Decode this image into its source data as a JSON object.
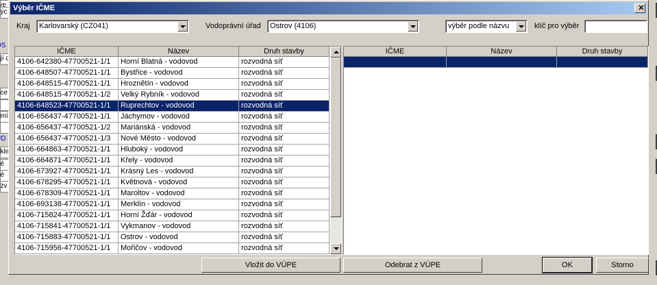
{
  "background_window": {
    "left_items": [
      "rve",
      "nýc",
      "OS",
      "ují d",
      "oce",
      "e",
      "emí",
      "í",
      "ÚD",
      "ákle",
      "né",
      "né",
      "ozv"
    ]
  },
  "dialog": {
    "title": "Výběr IČME",
    "close_glyph": "✕"
  },
  "filters": {
    "kraj_label": "Kraj",
    "kraj_value": "Karlovarský (CZ041)",
    "urad_label": "Vodoprávní úřad",
    "urad_value": "Ostrov (4106)",
    "mode_value": "výběr podle názvu",
    "key_label": "klíč pro výběr",
    "key_value": ""
  },
  "left_table": {
    "columns": [
      "IČME",
      "Název",
      "Druh stavby"
    ],
    "selected_index": 4,
    "rows": [
      [
        "4106-642380-47700521-1/1",
        "Horní Blatná - vodovod",
        "rozvodná síť"
      ],
      [
        "4106-648507-47700521-1/1",
        "Bystřice - vodovod",
        "rozvodná síť"
      ],
      [
        "4106-648515-47700521-1/1",
        "Hroznětín - vodovod",
        "rozvodná síť"
      ],
      [
        "4106-648515-47700521-1/2",
        "Velký Rybník - vodovod",
        "rozvodná síť"
      ],
      [
        "4106-648523-47700521-1/1",
        "Ruprechtov - vodovod",
        "rozvodná síť"
      ],
      [
        "4106-656437-47700521-1/1",
        "Jáchymov - vodovod",
        "rozvodná síť"
      ],
      [
        "4106-656437-47700521-1/2",
        "Mariánská - vodovod",
        "rozvodná síť"
      ],
      [
        "4106-656437-47700521-1/3",
        "Nové Město - vodovod",
        "rozvodná síť"
      ],
      [
        "4106-664863-47700521-1/1",
        "Hluboký - vodovod",
        "rozvodná síť"
      ],
      [
        "4106-664871-47700521-1/1",
        "Křely - vodovod",
        "rozvodná síť"
      ],
      [
        "4106-673927-47700521-1/1",
        "Krásný Les - vodovod",
        "rozvodná síť"
      ],
      [
        "4106-678295-47700521-1/1",
        "Květnová - vodovod",
        "rozvodná síť"
      ],
      [
        "4106-678309-47700521-1/1",
        "Maroltov - vodovod",
        "rozvodná síť"
      ],
      [
        "4106-693138-47700521-1/1",
        "Merklín - vodovod",
        "rozvodná síť"
      ],
      [
        "4106-715824-47700521-1/1",
        "Horní Žďár - vodovod",
        "rozvodná síť"
      ],
      [
        "4106-715841-47700521-1/1",
        "Vykmanov - vodovod",
        "rozvodná síť"
      ],
      [
        "4106-715883-47700521-1/1",
        "Ostrov - vodovod",
        "rozvodná síť"
      ],
      [
        "4106-715956-47700521-1/1",
        "Mořičov - vodovod",
        "rozvodná síť"
      ]
    ]
  },
  "right_table": {
    "columns": [
      "IČME",
      "Název",
      "Druh stavby"
    ],
    "rows": [
      [
        "",
        "",
        ""
      ]
    ]
  },
  "buttons": {
    "insert": "Vložit do VÚPE",
    "remove": "Odebrat z VÚPE",
    "ok": "OK",
    "cancel": "Storno"
  },
  "colors": {
    "selection": "#0a246a",
    "face": "#d4d0c8"
  }
}
